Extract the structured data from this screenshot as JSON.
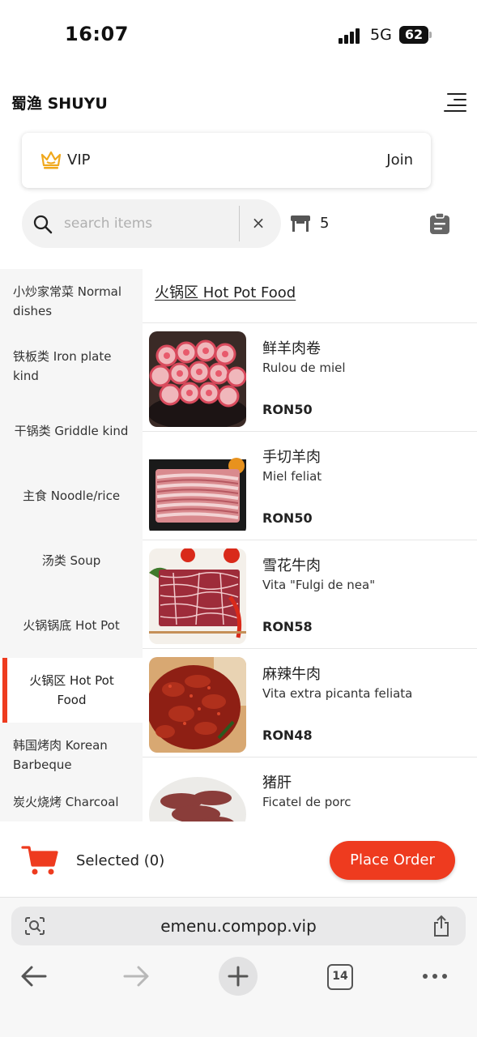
{
  "status_bar": {
    "time": "16:07",
    "network": "5G",
    "battery": "62"
  },
  "header": {
    "brand": "蜀渔 SHUYU"
  },
  "vip": {
    "label": "VIP",
    "join": "Join"
  },
  "search": {
    "placeholder": "search items",
    "value": "",
    "clear": "×"
  },
  "table": {
    "number": "5"
  },
  "categories": [
    {
      "label": "小炒家常菜 Normal dishes"
    },
    {
      "label": "铁板类 Iron plate kind"
    },
    {
      "label": "干锅类 Griddle kind"
    },
    {
      "label": "主食 Noodle/rice"
    },
    {
      "label": "汤类 Soup"
    },
    {
      "label": "火锅锅底 Hot Pot"
    },
    {
      "label": "火锅区 Hot Pot Food",
      "active": true
    },
    {
      "label": "韩国烤肉 Korean Barbeque"
    },
    {
      "label": "炭火烧烤 Charcoal"
    }
  ],
  "section": {
    "title": "火锅区 Hot Pot Food"
  },
  "items": [
    {
      "name": "鲜羊肉卷",
      "sub": "Rulou de miel",
      "price": "RON50",
      "image": "lamb-rolls"
    },
    {
      "name": "手切羊肉",
      "sub": "Miel feliat",
      "price": "RON50",
      "image": "sliced-lamb"
    },
    {
      "name": "雪花牛肉",
      "sub": "Vita \"Fulgi de nea\"",
      "price": "RON58",
      "image": "marbled-beef"
    },
    {
      "name": "麻辣牛肉",
      "sub": "Vita extra picanta feliata",
      "price": "RON48",
      "image": "spicy-beef"
    },
    {
      "name": "猪肝",
      "sub": "Ficatel de porc",
      "price": "",
      "image": "pork-liver"
    }
  ],
  "cart": {
    "selected": "Selected (0)",
    "place_order": "Place Order"
  },
  "browser": {
    "url": "emenu.compop.vip",
    "tabs_count": "14"
  },
  "colors": {
    "accent": "#ee3b1f",
    "vip_crown": "#f0a81c"
  }
}
